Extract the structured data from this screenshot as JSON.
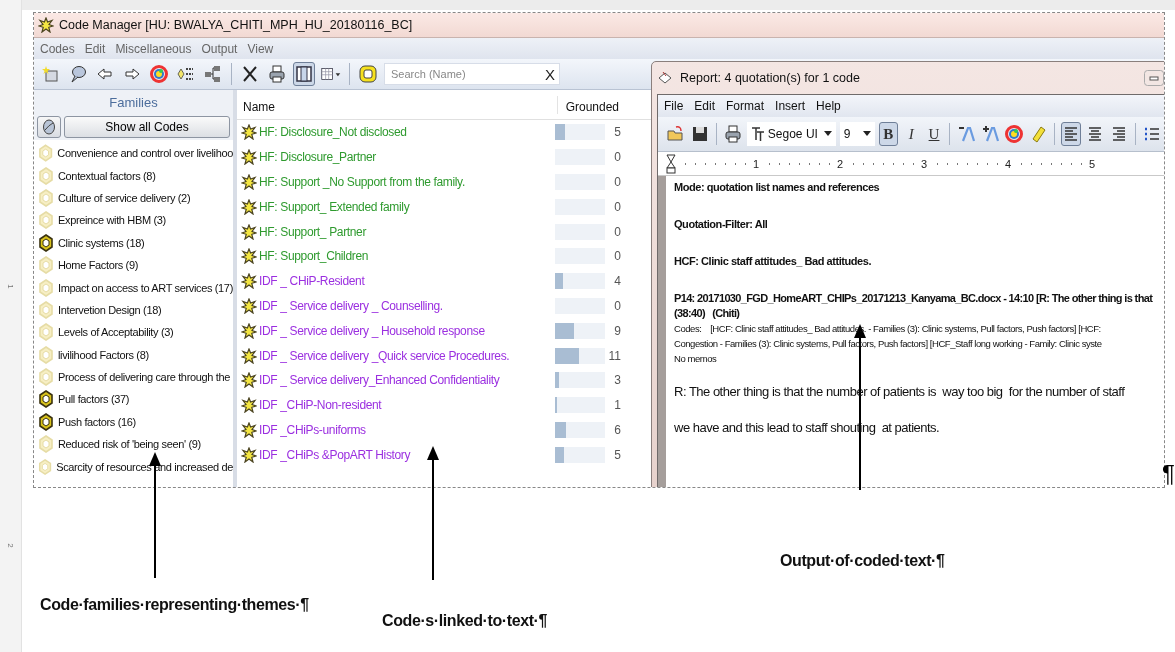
{
  "ruler_numbers": [
    "1",
    "2"
  ],
  "code_manager": {
    "title": "Code Manager [HU: BWALYA_CHITI_MPH_HU_20180116_BC]",
    "menu": [
      "Codes",
      "Edit",
      "Miscellaneous",
      "Output",
      "View"
    ],
    "toolbar": [
      [
        {
          "kind": "new-code",
          "selected": false
        },
        {
          "kind": "comment",
          "selected": false
        },
        {
          "kind": "back",
          "selected": false
        },
        {
          "kind": "forward",
          "selected": false
        },
        {
          "kind": "color",
          "selected": false
        },
        {
          "kind": "tree",
          "selected": false
        },
        {
          "kind": "network",
          "selected": false
        }
      ],
      [
        {
          "kind": "delete",
          "selected": false
        },
        {
          "kind": "print",
          "selected": false
        },
        {
          "kind": "pane",
          "selected": true
        },
        {
          "kind": "table",
          "selected": false
        }
      ],
      [
        {
          "kind": "code",
          "selected": false
        }
      ]
    ],
    "search": {
      "placeholder": "Search (Name)",
      "clear": "X"
    },
    "families": {
      "heading": "Families",
      "show_all": "Show all Codes",
      "items": [
        {
          "label": "Convenience and control over livelihoo",
          "active": false
        },
        {
          "label": "Contextual factors (8)",
          "active": false
        },
        {
          "label": "Culture of service delivery (2)",
          "active": false
        },
        {
          "label": "Expreince with HBM (3)",
          "active": false
        },
        {
          "label": "Clinic systems (18)",
          "active": true
        },
        {
          "label": "Home Factors (9)",
          "active": false
        },
        {
          "label": "Impact on access to ART services (17)",
          "active": false
        },
        {
          "label": "Intervetion Design (18)",
          "active": false
        },
        {
          "label": "Levels of Acceptability (3)",
          "active": false
        },
        {
          "label": "livilihood Factors (8)",
          "active": false
        },
        {
          "label": "Process of delivering care through the",
          "active": false
        },
        {
          "label": "Pull factors (37)",
          "active": true
        },
        {
          "label": "Push factors (16)",
          "active": true
        },
        {
          "label": "Reduced risk of 'being seen' (9)",
          "active": false
        },
        {
          "label": "Scarcity of resources and increased de",
          "active": false
        }
      ]
    },
    "codes": {
      "columns": [
        "Name",
        "Grounded"
      ],
      "rows": [
        {
          "name": "HF:  Disclosure_Not disclosed",
          "color": "#2e9a2e",
          "level": 0.2,
          "grounded": "5"
        },
        {
          "name": "HF:  Disclosure_Partner",
          "color": "#2e9a2e",
          "grounded": "0"
        },
        {
          "name": "HF:  Support _No Support from the family.",
          "color": "#2e9a2e",
          "grounded": "0"
        },
        {
          "name": "HF:  Support_ Extended family",
          "color": "#2e9a2e",
          "grounded": "0"
        },
        {
          "name": "HF:  Support_ Partner",
          "color": "#2e9a2e",
          "grounded": "0"
        },
        {
          "name": "HF:  Support_Children",
          "color": "#2e9a2e",
          "grounded": "0"
        },
        {
          "name": "IDF _ CHiP-Resident",
          "color": "#9b2fe0",
          "level": 0.15,
          "grounded": "4"
        },
        {
          "name": "IDF _ Service delivery _ Counselling.",
          "color": "#9b2fe0",
          "grounded": "0"
        },
        {
          "name": "IDF _ Service delivery _ Household response",
          "color": "#9b2fe0",
          "level": 0.38,
          "grounded": "9"
        },
        {
          "name": "IDF _ Service delivery _Quick service Procedures.",
          "color": "#9b2fe0",
          "level": 0.48,
          "grounded": "11"
        },
        {
          "name": "IDF _ Service delivery_Enhanced Confidentiality",
          "color": "#9b2fe0",
          "level": 0.08,
          "grounded": "3"
        },
        {
          "name": "IDF _CHiP-Non-resident",
          "color": "#9b2fe0",
          "level": 0.03,
          "grounded": "1"
        },
        {
          "name": "IDF _CHiPs-uniforms",
          "color": "#9b2fe0",
          "level": 0.22,
          "grounded": "6"
        },
        {
          "name": "IDF _CHiPs &PopART History",
          "color": "#9b2fe0",
          "level": 0.18,
          "grounded": "5"
        }
      ]
    }
  },
  "report": {
    "title": "Report: 4 quotation(s) for 1 code",
    "menu": [
      "File",
      "Edit",
      "Format",
      "Insert",
      "Help"
    ],
    "font": "Segoe UI",
    "size": "9",
    "format": [
      {
        "label": "B",
        "selected": true
      },
      {
        "label": "I",
        "selected": false
      },
      {
        "label": "U",
        "selected": false
      }
    ],
    "tools": [
      [
        {
          "kind": "shrink",
          "selected": false
        },
        {
          "kind": "grow",
          "selected": false
        },
        {
          "kind": "color",
          "selected": false
        },
        {
          "kind": "highlight",
          "selected": false
        }
      ],
      [
        {
          "kind": "align-left",
          "selected": true
        },
        {
          "kind": "align-center",
          "selected": false
        },
        {
          "kind": "align-right",
          "selected": false
        }
      ],
      [
        {
          "kind": "list",
          "selected": false
        }
      ]
    ],
    "ruler": [
      "1",
      "2",
      "3",
      "4",
      "5"
    ],
    "lines": [
      {
        "kind": "heading",
        "text": "Mode: quotation list names and references"
      },
      {
        "kind": "heading",
        "text": "Quotation-Filter: All"
      },
      {
        "kind": "heading",
        "text": "HCF: Clinic staff attitudes_ Bad attitudes."
      },
      {
        "kind": "ref",
        "text": "P14: 20171030_FGD_HomeART_CHIPs_20171213_Kanyama_BC.docx - 14:10 [R: The other thing is that"
      },
      {
        "kind": "ref",
        "text": "(38:40)   (Chiti)"
      },
      {
        "kind": "meta",
        "text": "Codes:    [HCF: Clinic staff attitudes_ Bad attitudes. - Families (3): Clinic systems, Pull factors, Push factors] [HCF:"
      },
      {
        "kind": "meta",
        "text": "Congestion - Families (3): Clinic systems, Pull factors, Push factors] [HCF_Staff long working - Family: Clinic syste"
      },
      {
        "kind": "meta",
        "text": "No memos"
      },
      {
        "kind": "quote",
        "text": "R: The other thing is that the number of patients is  way too big  for the number of staff"
      },
      {
        "kind": "quote",
        "text": "we have and this lead to staff shouting  at patients."
      }
    ]
  },
  "pilcrow": "¶",
  "captions": [
    "Code·families·representing·themes·¶",
    "Code·s·linked·to·text·¶",
    "Output·of·coded·text·¶"
  ]
}
